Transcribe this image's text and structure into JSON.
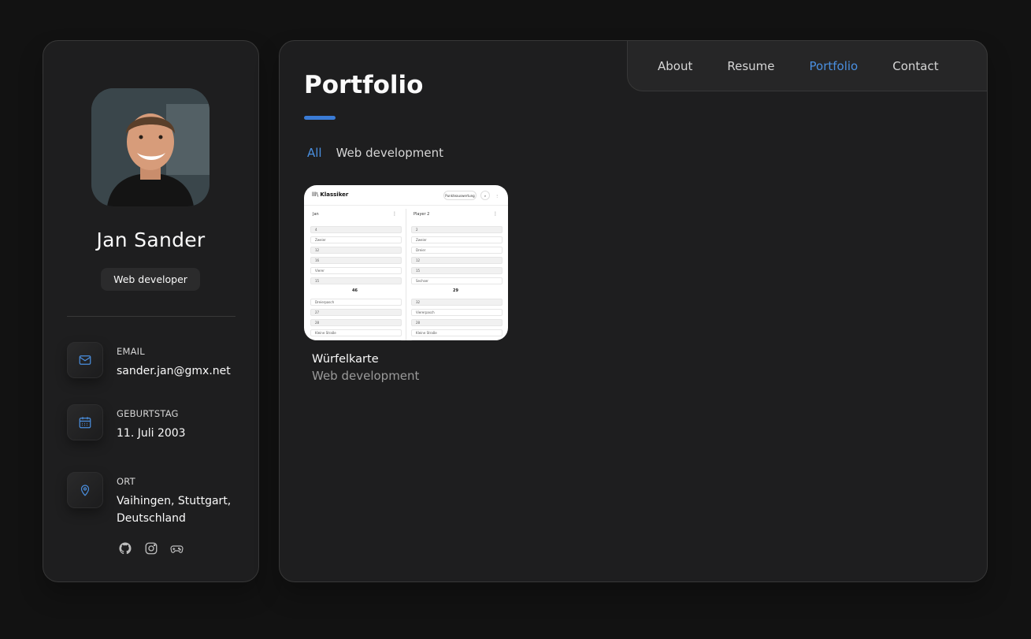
{
  "profile": {
    "name": "Jan Sander",
    "title": "Web developer",
    "avatar_icon": "person-avatar"
  },
  "contacts": [
    {
      "label": "Email",
      "value": "sander.jan@gmx.net",
      "icon": "mail-icon"
    },
    {
      "label": "Geburtstag",
      "value": "11. Juli 2003",
      "icon": "calendar-icon"
    },
    {
      "label": "Ort",
      "value": "Vaihingen, Stuttgart, Deutschland",
      "icon": "location-pin-icon"
    }
  ],
  "socials": [
    "github-icon",
    "instagram-icon",
    "gamepad-icon"
  ],
  "nav": {
    "items": [
      "About",
      "Resume",
      "Portfolio",
      "Contact"
    ],
    "active": "Portfolio"
  },
  "page": {
    "title": "Portfolio"
  },
  "filters": {
    "items": [
      "All",
      "Web development"
    ],
    "active": "All"
  },
  "projects": [
    {
      "title": "Würfelkarte",
      "category": "Web development",
      "thumbnail": {
        "app_name": "Klassiker",
        "button_label": "Punkteauswertung",
        "col1_title": "Jan",
        "col2_title": "Player 2",
        "col1_rows": [
          "4",
          "Zweier",
          "12",
          "16",
          "Vierer",
          "15"
        ],
        "col1_sum": "46",
        "col1_rows2": [
          "Dreierpasch",
          "27",
          "28",
          "Kleine Straße",
          "40"
        ],
        "col2_rows": [
          "2",
          "Zweier",
          "Dreier",
          "12",
          "15",
          "Sechser"
        ],
        "col2_sum": "29",
        "col2_rows2": [
          "32",
          "Viererpasch",
          "28",
          "Kleine Straße",
          "40"
        ]
      }
    }
  ],
  "colors": {
    "accent": "#4a8fe0",
    "background": "#121212",
    "card": "#1e1e1f"
  }
}
